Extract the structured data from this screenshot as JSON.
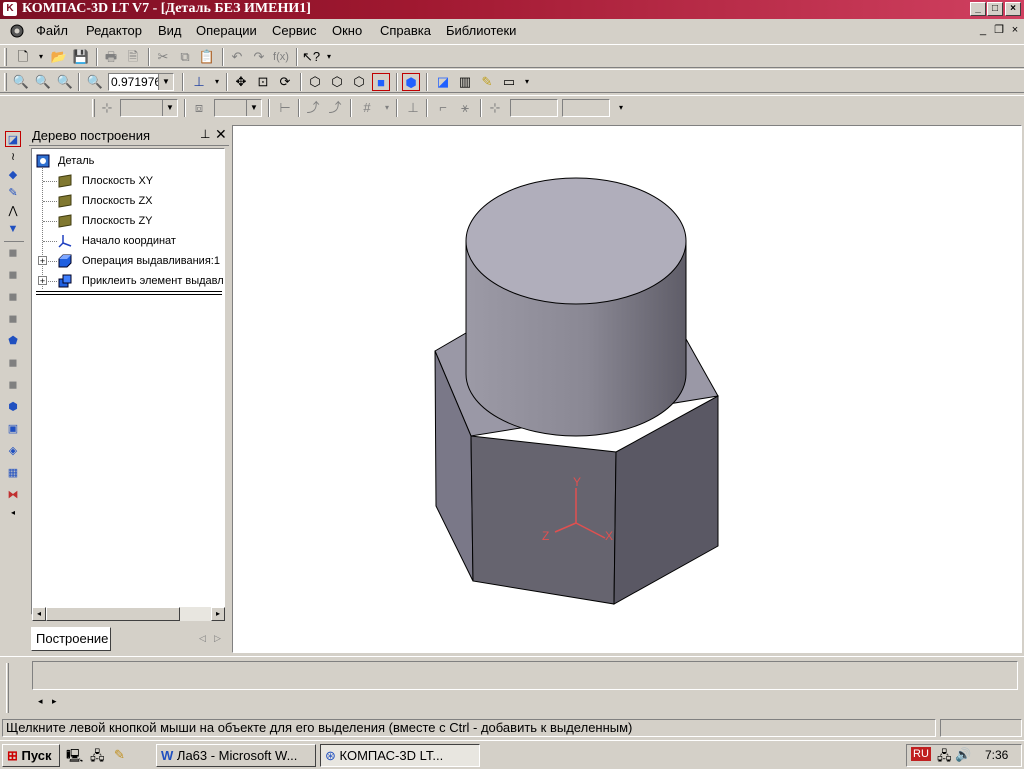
{
  "window": {
    "title": "КОМПАС-3D LT V7 - [Деталь БЕЗ ИМЕНИ1]"
  },
  "menu": {
    "items": [
      "Файл",
      "Редактор",
      "Вид",
      "Операции",
      "Сервис",
      "Окно",
      "Справка",
      "Библиотеки"
    ]
  },
  "toolbar": {
    "zoom_value": "0.971976"
  },
  "tree": {
    "header": "Дерево построения",
    "root": "Деталь",
    "nodes": [
      "Плоскость XY",
      "Плоскость ZX",
      "Плоскость ZY",
      "Начало координат",
      "Операция выдавливания:1",
      "Приклеить элемент выдавл"
    ],
    "tab": "Построение"
  },
  "viewport": {
    "axes": {
      "x": "X",
      "y": "Y",
      "z": "Z"
    },
    "axis_color": "#e05050"
  },
  "status": {
    "text": "Щелкните левой кнопкой мыши на объекте для его выделения (вместе с Ctrl - добавить к выделенным)"
  },
  "taskbar": {
    "start": "Пуск",
    "tasks": [
      "Ла63 - Microsoft W...",
      "КОМПАС-3D LT..."
    ],
    "lang": "RU",
    "clock": "7:36"
  }
}
